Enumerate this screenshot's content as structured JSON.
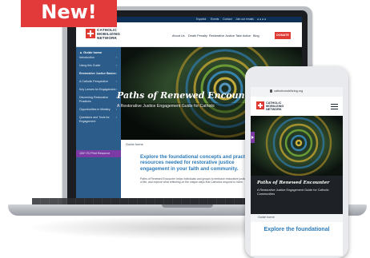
{
  "badge": {
    "label": "New!"
  },
  "laptop": {
    "top_links": [
      "Español",
      "Events",
      "Contact",
      "Join our emails"
    ],
    "logo_lines": [
      "CATHOLIC",
      "MOBILIZING",
      "NETWORK"
    ],
    "nav": [
      "About Us",
      "Death Penalty",
      "Restorative Justice",
      "Take Action",
      "Blog"
    ],
    "donate_label": "DONATE",
    "sidebar": {
      "title": "Guide home",
      "items": [
        "Introduction",
        "Using this Guide",
        "Restorative Justice Basics",
        "A Catholic Perspective",
        "Key Lenses for Engagement",
        "Discerning Restorative",
        "Practices",
        "Opportunities in Ministry",
        "Questions and Tools for",
        "Engagement",
        "100+ RJ Print Resource"
      ]
    },
    "hero": {
      "title": "Paths of Renewed Encounter",
      "subtitle": "A Restorative Justice Engagement Guide for Catholic"
    },
    "breadcrumb": "Guide home",
    "content": {
      "heading": "Explore the foundational concepts and practical resources needed for restorative justice engagement in your faith and community.",
      "body": "Paths of Renewed Encounter helps individuals and groups to embrace restorative justice as a way of life, and explore what reflecting on the unique ways that Catholics respond to harm."
    }
  },
  "phone": {
    "url": "catholicmobilizing.org",
    "logo_lines": [
      "CATHOLIC",
      "MOBILIZING",
      "NETWORK"
    ],
    "hero": {
      "title": "Paths of Renewed Encounter",
      "subtitle": "A Restorative Justice Engagement Guide for Catholic Communities"
    },
    "breadcrumb": "Guide home",
    "heading": "Explore the foundational"
  },
  "colors": {
    "accent_red": "#e03a35",
    "navy": "#0d2f55",
    "sidebar_blue": "#2c5c8a",
    "highlight_purple": "#7b3aa4",
    "link_blue": "#2b7ab8"
  }
}
